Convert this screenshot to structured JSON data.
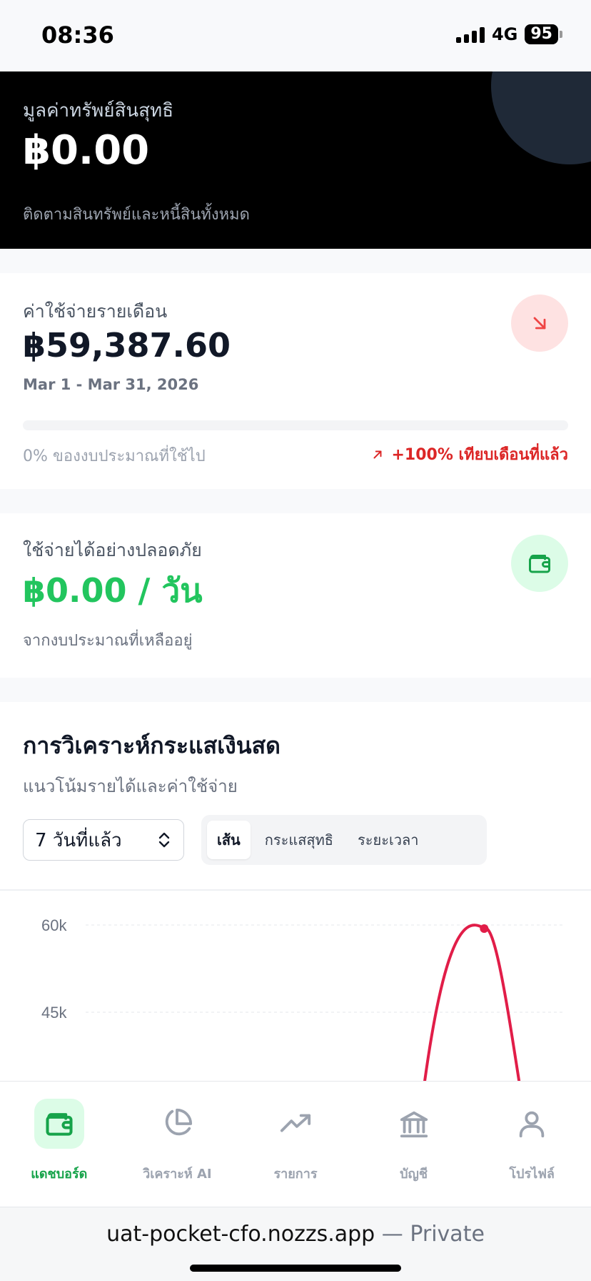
{
  "status_bar": {
    "time": "08:36",
    "network": "4G",
    "battery": "95"
  },
  "net_worth": {
    "label": "มูลค่าทรัพย์สินสุทธิ",
    "value": "฿0.00",
    "subtitle": "ติดตามสินทรัพย์และหนี้สินทั้งหมด"
  },
  "monthly_expense": {
    "label": "ค่าใช้จ่ายรายเดือน",
    "value": "฿59,387.60",
    "date_range": "Mar 1 - Mar 31, 2026",
    "budget_used_fraction": 0.0,
    "budget_text": "0% ของงบประมาณที่ใช้ไป",
    "change_text": "+100% เทียบเดือนที่แล้ว",
    "icon": "arrow-down-right-icon",
    "colors": {
      "icon_bg": "#fee2e2",
      "icon": "#ef4444",
      "change": "#dc2626"
    }
  },
  "safe_to_spend": {
    "label": "ใช้จ่ายได้อย่างปลอดภัย",
    "value": "฿0.00 / วัน",
    "subtitle": "จากงบประมาณที่เหลืออยู่",
    "icon": "wallet-icon",
    "colors": {
      "value": "#22c55e",
      "icon_bg": "#dcfce7",
      "icon": "#16a34a"
    }
  },
  "cashflow": {
    "title": "การวิเคราะห์กระแสเงินสด",
    "subtitle": "แนวโน้มรายได้และค่าใช้จ่าย",
    "range_selected": "7 วันที่แล้ว",
    "view_tabs": [
      "เส้น",
      "กระแสสุทธิ",
      "ระยะเวลา"
    ],
    "active_tab": 0
  },
  "chart_data": {
    "type": "line",
    "y_ticks": [
      "60k",
      "45k"
    ],
    "series": [
      {
        "points": [
          [
            5,
            0
          ],
          [
            6,
            59387.6
          ],
          [
            7,
            0
          ]
        ],
        "color": "#e11d48"
      }
    ],
    "x_range": [
      1,
      7
    ],
    "ylim": [
      0,
      60000
    ],
    "grid": true
  },
  "bottom_nav": {
    "items": [
      {
        "label": "แดชบอร์ด",
        "icon": "wallet-icon",
        "active": true
      },
      {
        "label": "วิเคราะห์ AI",
        "icon": "pie-chart-icon",
        "active": false
      },
      {
        "label": "รายการ",
        "icon": "trending-up-icon",
        "active": false
      },
      {
        "label": "บัญชี",
        "icon": "bank-icon",
        "active": false
      },
      {
        "label": "โปรไฟล์",
        "icon": "user-icon",
        "active": false
      }
    ]
  },
  "browser": {
    "url": "uat-pocket-cfo.nozzs.app",
    "mode": "— Private"
  }
}
